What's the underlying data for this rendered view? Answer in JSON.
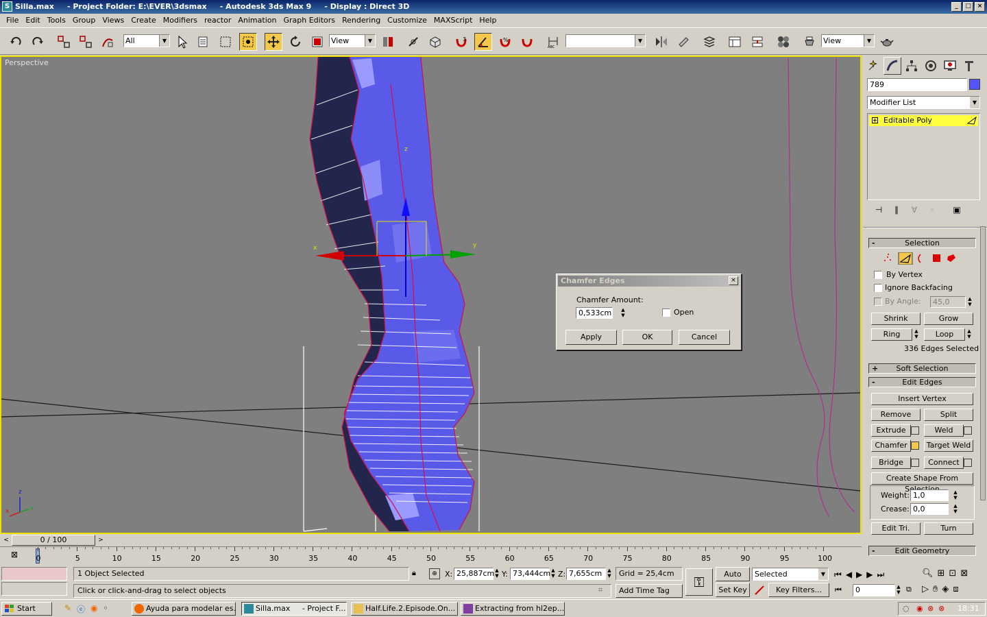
{
  "window": {
    "title": "Silla.max     - Project Folder: E:\\EVER\\3dsmax     - Autodesk 3ds Max 9     - Display : Direct 3D"
  },
  "menu": [
    "File",
    "Edit",
    "Tools",
    "Group",
    "Views",
    "Create",
    "Modifiers",
    "reactor",
    "Animation",
    "Graph Editors",
    "Rendering",
    "Customize",
    "MAXScript",
    "Help"
  ],
  "toolbar": {
    "selection_filter": "All",
    "ref_coord": "View",
    "named_selection": "",
    "view_combo": "View"
  },
  "viewport": {
    "label": "Perspective",
    "gizmo_x": "x",
    "gizmo_y": "y",
    "gizmo_z": "z",
    "axis_x": "x",
    "axis_y": "y",
    "axis_z": "z"
  },
  "command_panel": {
    "object_name": "789",
    "object_color": "#5555ff",
    "modifier_list": "Modifier List",
    "stack_item": "Editable Poly",
    "selection": {
      "title": "Selection",
      "by_vertex": "By Vertex",
      "ignore_backfacing": "Ignore Backfacing",
      "by_angle": "By Angle:",
      "by_angle_value": "45,0",
      "shrink": "Shrink",
      "grow": "Grow",
      "ring": "Ring",
      "loop": "Loop",
      "count": "336 Edges Selected"
    },
    "soft_selection": "Soft Selection",
    "edit_edges": {
      "title": "Edit Edges",
      "insert_vertex": "Insert Vertex",
      "remove": "Remove",
      "split": "Split",
      "extrude": "Extrude",
      "weld": "Weld",
      "chamfer": "Chamfer",
      "target_weld": "Target Weld",
      "bridge": "Bridge",
      "connect": "Connect",
      "create_shape": "Create Shape From Selection",
      "weight_label": "Weight:",
      "weight_value": "1,0",
      "crease_label": "Crease:",
      "crease_value": "0,0",
      "edit_tri": "Edit Tri.",
      "turn": "Turn"
    },
    "edit_geometry": "Edit Geometry"
  },
  "dialog": {
    "title": "Chamfer Edges",
    "amount_label": "Chamfer Amount:",
    "amount_value": "0,533cm",
    "open_label": "Open",
    "apply": "Apply",
    "ok": "OK",
    "cancel": "Cancel"
  },
  "timeline": {
    "frame_counter": "0 / 100",
    "ticks": [
      "0",
      "5",
      "10",
      "15",
      "20",
      "25",
      "30",
      "35",
      "40",
      "45",
      "50",
      "55",
      "60",
      "65",
      "70",
      "75",
      "80",
      "85",
      "90",
      "95",
      "100"
    ]
  },
  "status": {
    "selected": "1 Object Selected",
    "prompt": "Click or click-and-drag to select objects",
    "x_label": "X:",
    "x_value": "25,887cm",
    "y_label": "Y:",
    "y_value": "73,444cm",
    "z_label": "Z:",
    "z_value": "7,655cm",
    "grid": "Grid = 25,4cm",
    "add_time_tag": "Add Time Tag",
    "auto_key": "Auto Key",
    "set_key": "Set Key",
    "key_mode": "Selected",
    "key_filters": "Key Filters...",
    "current_frame": "0"
  },
  "taskbar": {
    "start": "Start",
    "tasks": [
      "Ayuda para modelar es...",
      "Silla.max     - Project F...",
      "Half.Life.2.Episode.On...",
      "Extracting from hl2ep..."
    ],
    "clock": "18:31"
  }
}
